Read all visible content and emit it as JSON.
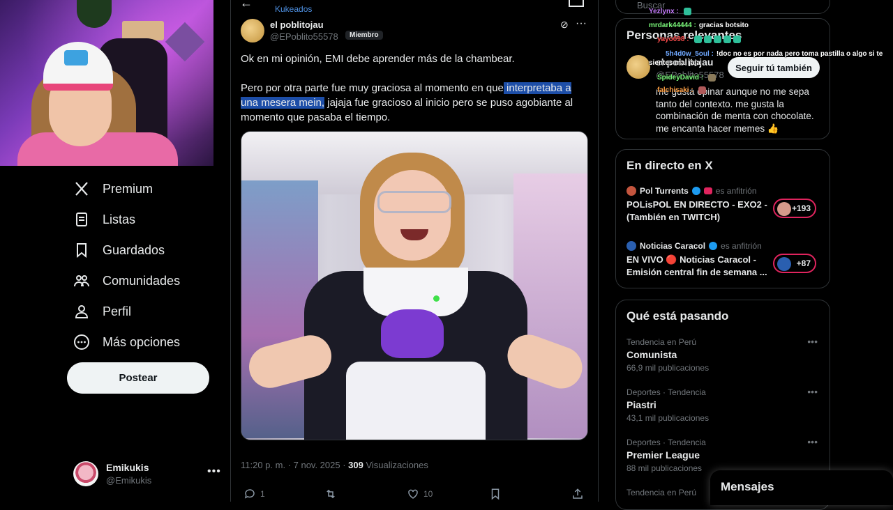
{
  "left_nav": {
    "items": [
      {
        "label": "Premium",
        "icon": "x-logo-icon"
      },
      {
        "label": "Listas",
        "icon": "list-icon"
      },
      {
        "label": "Guardados",
        "icon": "bookmark-icon"
      },
      {
        "label": "Comunidades",
        "icon": "communities-icon"
      },
      {
        "label": "Perfil",
        "icon": "profile-icon"
      },
      {
        "label": "Más opciones",
        "icon": "more-circle-icon"
      }
    ],
    "post_button": "Postear",
    "account": {
      "name": "Emikukis",
      "handle": "@Emikukis"
    }
  },
  "tweet": {
    "community_label": "Kukeados",
    "author_name": "el poblitojau",
    "author_handle": "@EPoblito55578",
    "member_badge": "Miembro",
    "text_p1": "Ok en mi opinión, EMI debe aprender más de la chambear.",
    "text_p2_a": "Pero por otra parte fue muy graciosa al momento en que",
    "text_p2_hl": " interpretaba a una mesera mein,",
    "text_p2_b": " jajaja fue gracioso al inicio pero se puso agobiante al momento que pasaba el tiempo.",
    "time": "11:20 p. m. · 7 nov. 2025 · ",
    "views_count": "309",
    "views_label": " Visualizaciones",
    "replies": "1",
    "likes": "10"
  },
  "right": {
    "search_placeholder": "Buscar",
    "relevant": {
      "title": "Personas relevantes",
      "name": "el poblitojau",
      "handle": "@EPoblito55578",
      "follow_label": "Seguir tú también",
      "bio": "me gusta opinar aunque no me sepa tanto del contexto. me gusta la combinación de menta con chocolate. me encanta hacer memes 👍"
    },
    "live": {
      "title": "En directo en X",
      "rows": [
        {
          "host": "Pol Turrents",
          "host_suffix": "es anfitrión",
          "title": "POLisPOL EN DIRECTO - EXO2 - (También en TWITCH)",
          "count": "+193"
        },
        {
          "host": "Noticias Caracol",
          "host_suffix": "es anfitrión",
          "title": "EN VIVO 🔴 Noticias Caracol - Emisión central fin de semana ...",
          "count": "+87"
        }
      ]
    },
    "trends": {
      "title": "Qué está pasando",
      "items": [
        {
          "category": "Tendencia en Perú",
          "name": "Comunista",
          "count": "66,9 mil publicaciones"
        },
        {
          "category": "Deportes · Tendencia",
          "name": "Piastri",
          "count": "43,1 mil publicaciones"
        },
        {
          "category": "Deportes · Tendencia",
          "name": "Premier League",
          "count": "88 mil publicaciones"
        },
        {
          "category": "Tendencia en Perú",
          "name": "",
          "count": ""
        }
      ]
    },
    "messages_label": "Mensajes"
  },
  "chat": [
    {
      "user": "Yezlynx :",
      "text": "",
      "color": "#c77dff"
    },
    {
      "user": "mrdark44444 :",
      "text": "gracias botsito",
      "color": "#7cfc7c"
    },
    {
      "user": "yayo098 :",
      "text": "",
      "color": "#ff4d4d"
    },
    {
      "user": "5h4d0w_5oul :",
      "text": "!doc no es por nada pero toma pastilla o algo si te sientes mal jaja",
      "color": "#6fa8ff"
    },
    {
      "user": "SpideyDavid :",
      "text": "",
      "color": "#7cfc7c"
    },
    {
      "user": "falchisaki :",
      "text": "",
      "color": "#ff9f43"
    }
  ]
}
